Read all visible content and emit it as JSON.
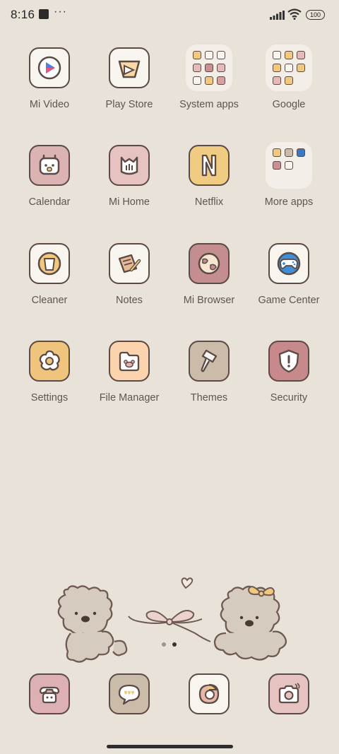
{
  "status_bar": {
    "time": "8:16",
    "overflow": "···",
    "battery": "100"
  },
  "rows": [
    [
      {
        "label": "Mi Video",
        "icon": "play-icon",
        "color": "#f8f4ee"
      },
      {
        "label": "Play Store",
        "icon": "play-store-icon",
        "color": "#f8f4ee"
      },
      {
        "label": "System apps",
        "icon": "folder-icon",
        "color": "#f3eee8"
      },
      {
        "label": "Google",
        "icon": "folder-icon",
        "color": "#f3eee8"
      }
    ],
    [
      {
        "label": "Calendar",
        "icon": "calendar-icon",
        "color": "#dcb3b3"
      },
      {
        "label": "Mi Home",
        "icon": "home-icon",
        "color": "#e6c2c0"
      },
      {
        "label": "Netflix",
        "icon": "netflix-icon",
        "color": "#f0cc82"
      },
      {
        "label": "More apps",
        "icon": "folder-icon",
        "color": "#f3eee8"
      }
    ],
    [
      {
        "label": "Cleaner",
        "icon": "trash-icon",
        "color": "#f8f4ee"
      },
      {
        "label": "Notes",
        "icon": "notes-icon",
        "color": "#f8f4ee"
      },
      {
        "label": "Mi Browser",
        "icon": "globe-icon",
        "color": "#c48d8f"
      },
      {
        "label": "Game Center",
        "icon": "gamepad-icon",
        "color": "#f8f4ee"
      }
    ],
    [
      {
        "label": "Settings",
        "icon": "gear-icon",
        "color": "#efc47d"
      },
      {
        "label": "File Manager",
        "icon": "file-folder-icon",
        "color": "#fbd3ad"
      },
      {
        "label": "Themes",
        "icon": "brush-icon",
        "color": "#cbbba9"
      },
      {
        "label": "Security",
        "icon": "shield-icon",
        "color": "#c7898b"
      }
    ]
  ],
  "dock": [
    {
      "icon": "phone-icon",
      "color": "#ddb0b3"
    },
    {
      "icon": "message-icon",
      "color": "#cbbca9"
    },
    {
      "icon": "chrome-icon",
      "color": "#f8f4ee"
    },
    {
      "icon": "camera-icon",
      "color": "#e6c2c0"
    }
  ],
  "colors": {
    "background": "#e9e2d9",
    "label": "#5c5650",
    "outline": "#5b4a45"
  }
}
